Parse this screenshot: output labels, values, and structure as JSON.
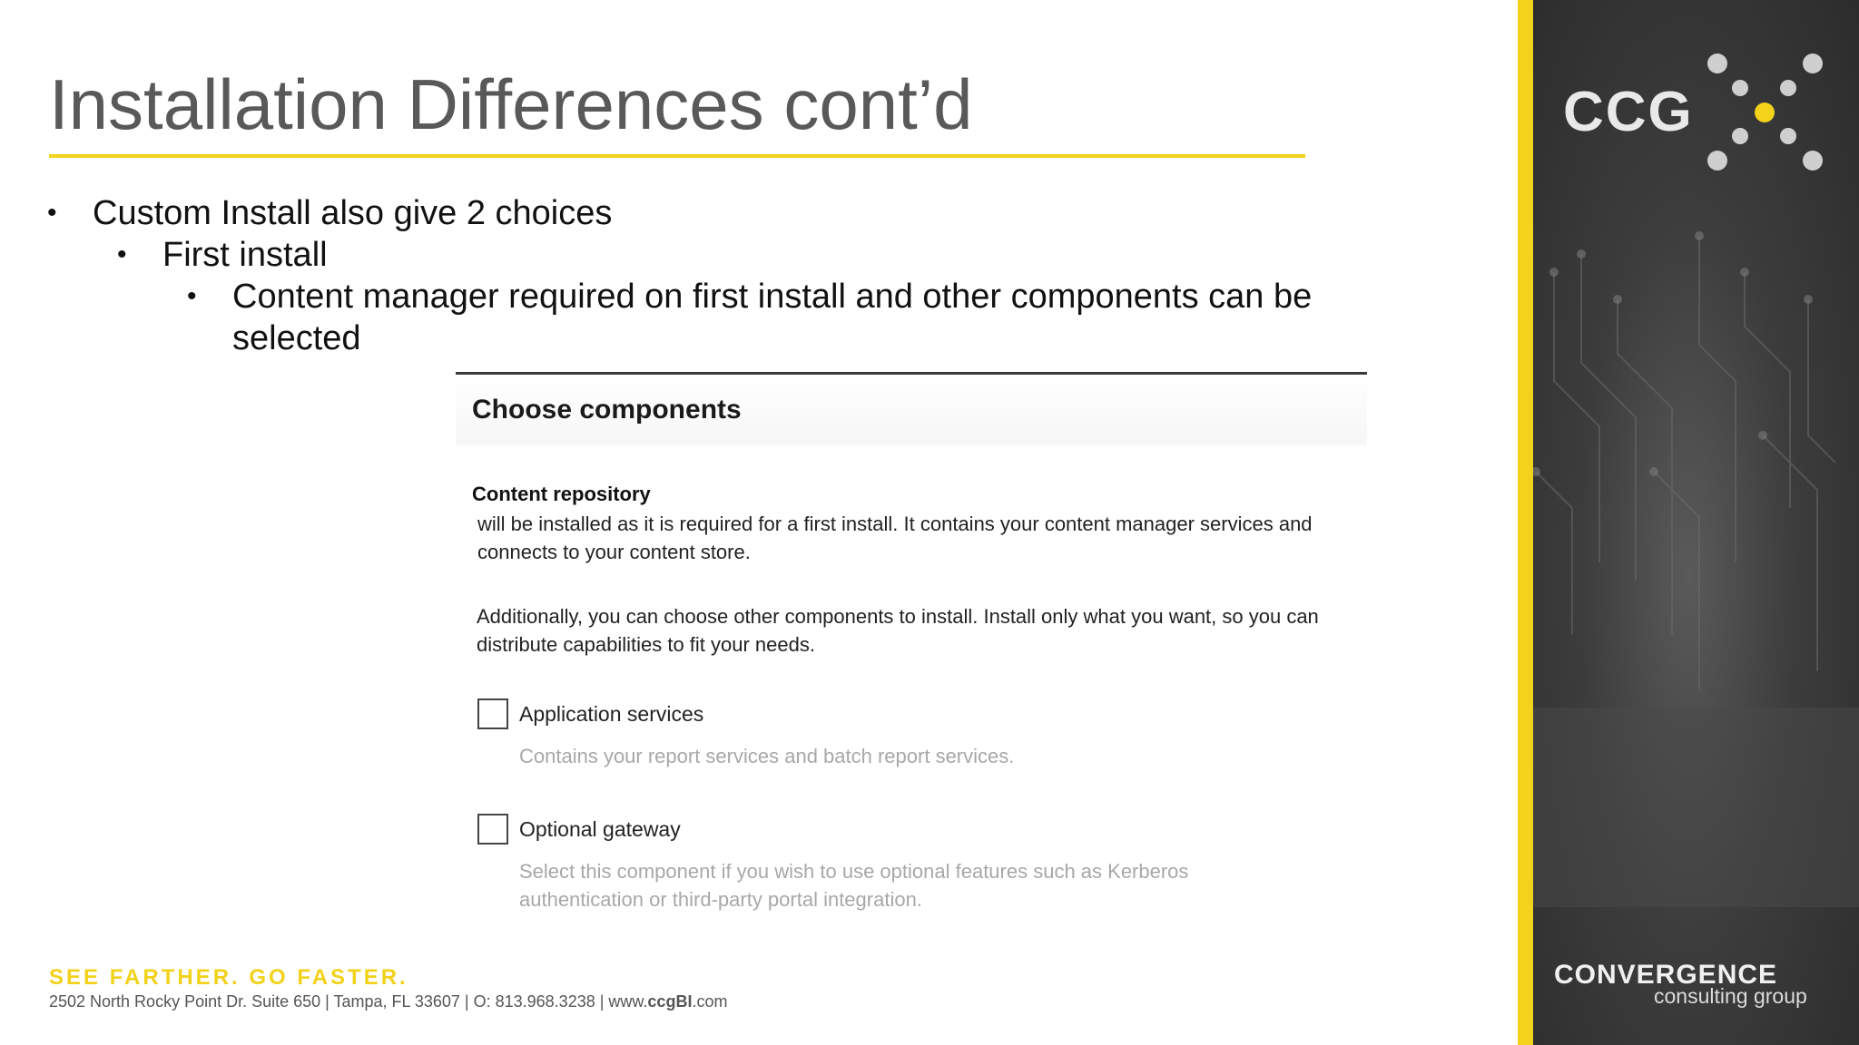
{
  "slide": {
    "title": "Installation Differences cont’d",
    "bullets": [
      {
        "level": 1,
        "text": "Custom Install also give 2 choices"
      },
      {
        "level": 2,
        "text": "First install"
      },
      {
        "level": 3,
        "text": "Content manager required on first install and other components can be selected"
      }
    ],
    "bullet_glyph": "•"
  },
  "dialog": {
    "title": "Choose components",
    "repository_label": "Content repository",
    "repository_text": "will be installed as it is required for a first install. It contains your content manager services and connects to your content store.",
    "additional_text": "Additionally, you can choose other components to install. Install only what you want, so you can distribute capabilities to fit your needs.",
    "options": [
      {
        "label": "Application services",
        "description": "Contains your report services and batch report services.",
        "checked": false
      },
      {
        "label": "Optional gateway",
        "description": "Select this component if you wish to use optional features such as Kerberos authentication or third-party portal integration.",
        "checked": false
      }
    ]
  },
  "footer": {
    "tagline": "SEE FARTHER. GO FASTER.",
    "address_prefix": "2502 North Rocky Point Dr. Suite 650 | Tampa, FL 33607 | O: 813.968.3238 | www.",
    "address_bold": "ccgBI",
    "address_suffix": ".com"
  },
  "brand": {
    "logo_text": "CCG",
    "company_line1": "CONVERGENCE",
    "company_line2": "consulting group",
    "accent_color": "#f2d21b"
  }
}
